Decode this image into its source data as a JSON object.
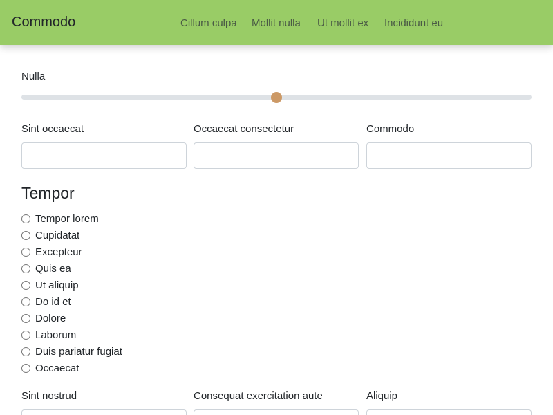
{
  "navbar": {
    "brand": "Commodo",
    "links": [
      "Cillum culpa",
      "Mollit nulla",
      "Ut mollit ex",
      "Incididunt eu"
    ]
  },
  "slider": {
    "label": "Nulla",
    "value_fraction": 0.5
  },
  "fields_row_1": [
    {
      "label": "Sint occaecat",
      "value": ""
    },
    {
      "label": "Occaecat consectetur",
      "value": ""
    },
    {
      "label": "Commodo",
      "value": ""
    }
  ],
  "radio_group": {
    "title": "Tempor",
    "options": [
      "Tempor lorem",
      "Cupidatat",
      "Excepteur",
      "Quis ea",
      "Ut aliquip",
      "Do id et",
      "Dolore",
      "Laborum",
      "Duis pariatur fugiat",
      "Occaecat"
    ]
  },
  "fields_row_2": [
    {
      "label": "Sint nostrud",
      "value": ""
    },
    {
      "label": "Consequat exercitation aute",
      "value": ""
    },
    {
      "label": "Aliquip",
      "value": ""
    }
  ],
  "colors": {
    "navbar_bg": "#99cc66",
    "slider_thumb": "#cc9966",
    "slider_track": "#dee2e6"
  }
}
